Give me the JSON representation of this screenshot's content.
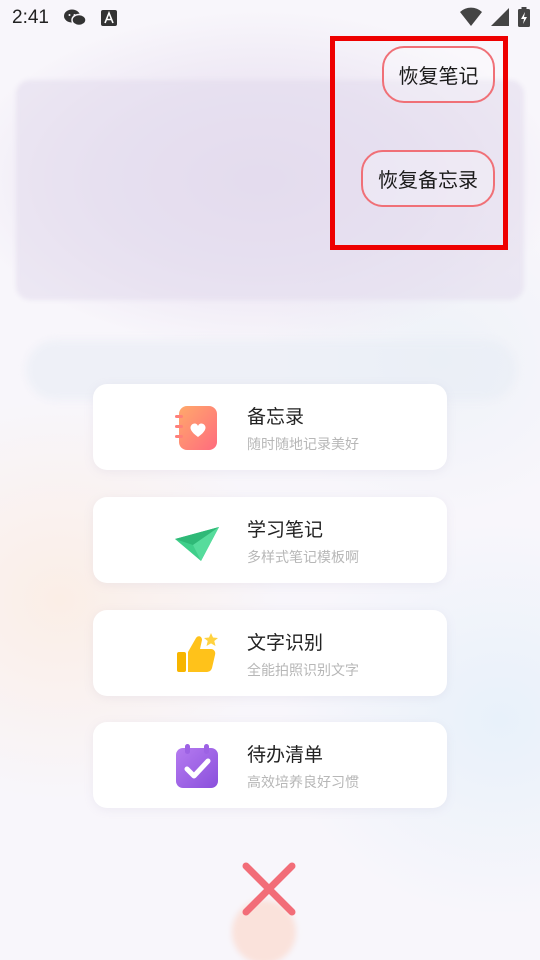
{
  "status_bar": {
    "time": "2:41",
    "icons": [
      "wechat-icon",
      "keyboard-a-icon",
      "wifi-icon",
      "signal-icon",
      "battery-charging-icon"
    ]
  },
  "restore": {
    "notes_label": "恢复笔记",
    "memo_label": "恢复备忘录",
    "highlight_color": "#ee0000",
    "pill_border_color": "#f07077"
  },
  "menu": [
    {
      "title": "备忘录",
      "subtitle": "随时随地记录美好",
      "icon": "memo-heart-icon"
    },
    {
      "title": "学习笔记",
      "subtitle": "多样式笔记模板啊",
      "icon": "paper-plane-icon"
    },
    {
      "title": "文字识别",
      "subtitle": "全能拍照识别文字",
      "icon": "thumbs-up-icon"
    },
    {
      "title": "待办清单",
      "subtitle": "高效培养良好习惯",
      "icon": "calendar-check-icon"
    }
  ],
  "close": {
    "icon": "close-x-icon",
    "color": "#f26d78"
  }
}
